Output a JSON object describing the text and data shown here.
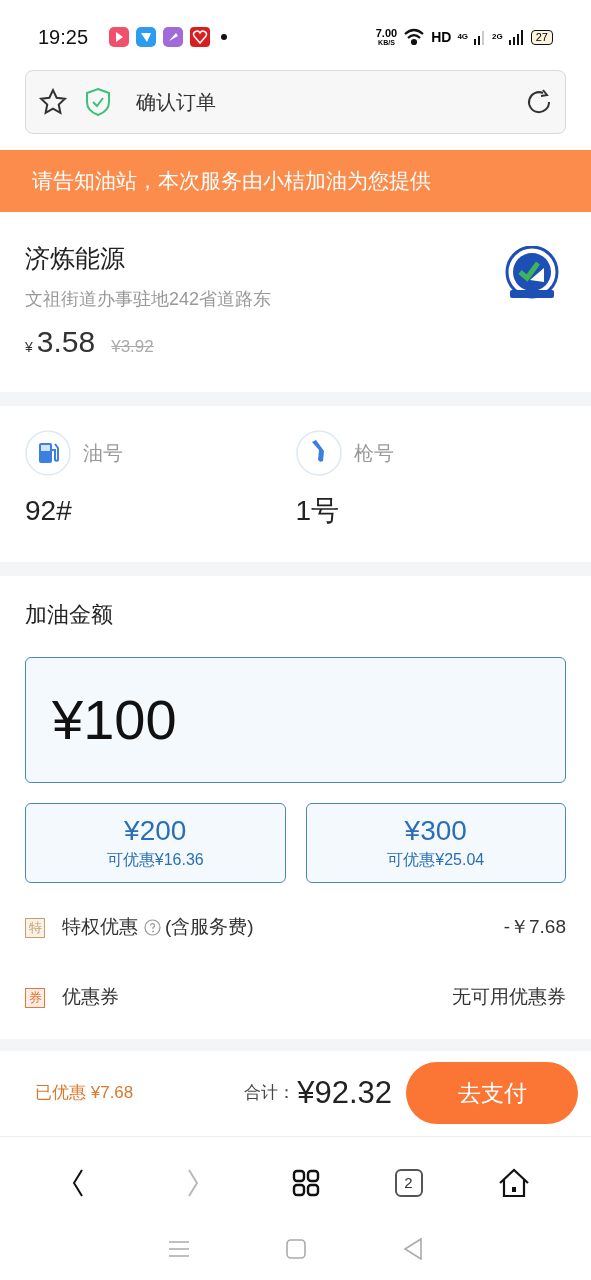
{
  "status_bar": {
    "time": "19:25",
    "speed_value": "7.00",
    "speed_unit": "KB/S",
    "hd": "HD",
    "sim1": "4G",
    "sim2": "2G",
    "battery": "27"
  },
  "address_bar": {
    "title": "确认订单"
  },
  "banner": {
    "text": "请告知油站，本次服务由小桔加油为您提供"
  },
  "station": {
    "name": "济炼能源",
    "address": "文祖街道办事驻地242省道路东",
    "currency": "¥",
    "price": "3.58",
    "original_price": "¥3.92"
  },
  "fuel": [
    {
      "kind": "pump",
      "label": "油号",
      "value": "92#"
    },
    {
      "kind": "nozzle",
      "label": "枪号",
      "value": "1号"
    }
  ],
  "amount": {
    "title": "加油金额",
    "value": "¥100",
    "options": [
      {
        "amount": "¥200",
        "discount": "可优惠¥16.36"
      },
      {
        "amount": "¥300",
        "discount": "可优惠¥25.04"
      }
    ]
  },
  "discounts": [
    {
      "badge": "特",
      "color": "#c9a063",
      "label": "特权优惠",
      "help": true,
      "note": "(含服务费)",
      "value": "-￥7.68"
    },
    {
      "badge": "券",
      "color": "#e07a3a",
      "label": "优惠券",
      "help": false,
      "value": "无可用优惠券"
    }
  ],
  "checkout": {
    "saved": "已优惠 ¥7.68",
    "total_label": "合计：",
    "total": "¥92.32",
    "pay_button": "去支付"
  },
  "browser_nav": [
    {
      "kind": "back",
      "disabled": false
    },
    {
      "kind": "forward",
      "disabled": true
    },
    {
      "kind": "grid",
      "disabled": false
    },
    {
      "kind": "tabs",
      "count": "2",
      "disabled": false
    },
    {
      "kind": "home",
      "disabled": false
    }
  ]
}
